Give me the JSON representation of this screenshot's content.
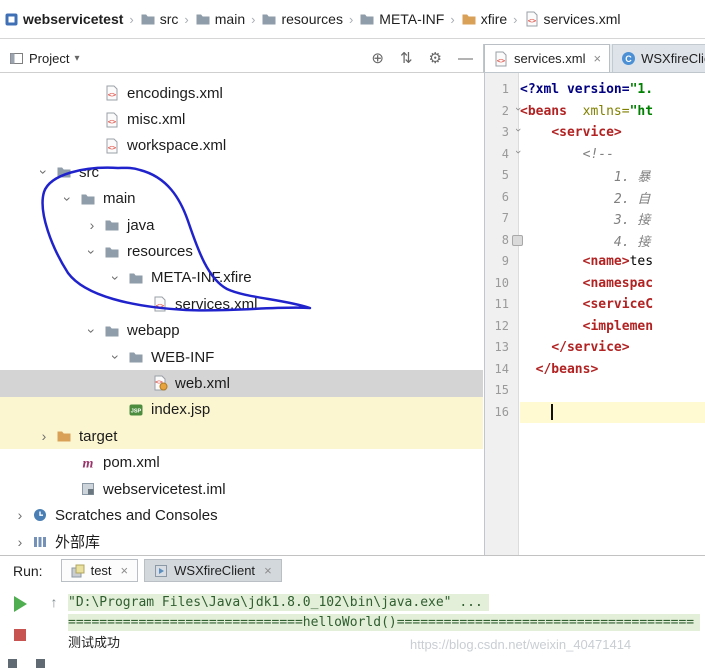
{
  "breadcrumb": {
    "separator": "›",
    "items": [
      {
        "label": "webservicetest",
        "icon": "project"
      },
      {
        "label": "src",
        "icon": "folder"
      },
      {
        "label": "main",
        "icon": "folder"
      },
      {
        "label": "resources",
        "icon": "folder"
      },
      {
        "label": "META-INF",
        "icon": "folder"
      },
      {
        "label": "xfire",
        "icon": "folder-orange"
      },
      {
        "label": "services.xml",
        "icon": "xml-file"
      }
    ]
  },
  "project_panel": {
    "title": "Project",
    "dropdown_arrow": "▾",
    "toolbar_icons": [
      {
        "name": "locate-icon",
        "glyph": "⊕"
      },
      {
        "name": "collapse-all-icon",
        "glyph": "⇅"
      },
      {
        "name": "settings-gear-icon",
        "glyph": "⚙"
      },
      {
        "name": "hide-panel-icon",
        "glyph": "—"
      }
    ],
    "tree": [
      {
        "label": "encodings.xml",
        "icon": "xml-file",
        "level": 3
      },
      {
        "label": "misc.xml",
        "icon": "xml-file",
        "level": 3
      },
      {
        "label": "workspace.xml",
        "icon": "xml-file",
        "level": 3
      },
      {
        "label": "src",
        "icon": "folder",
        "level": 1,
        "arrow": "down"
      },
      {
        "label": "main",
        "icon": "folder",
        "level": 2,
        "arrow": "down"
      },
      {
        "label": "java",
        "icon": "folder",
        "level": 3,
        "arrow": "right"
      },
      {
        "label": "resources",
        "icon": "folder",
        "level": 3,
        "arrow": "down"
      },
      {
        "label": "META-INF.xfire",
        "icon": "folder",
        "level": 4,
        "arrow": "down"
      },
      {
        "label": "services.xml",
        "icon": "xml-file",
        "level": 5
      },
      {
        "label": "webapp",
        "icon": "folder",
        "level": 3,
        "arrow": "down"
      },
      {
        "label": "WEB-INF",
        "icon": "folder",
        "level": 4,
        "arrow": "down"
      },
      {
        "label": "web.xml",
        "icon": "web-xml",
        "level": 5,
        "selected": true
      },
      {
        "label": "index.jsp",
        "icon": "jsp-file",
        "level": 4,
        "highlight": true
      },
      {
        "label": "target",
        "icon": "folder-orange",
        "level": 1,
        "arrow": "right",
        "highlight": true
      },
      {
        "label": "pom.xml",
        "icon": "maven",
        "level": 2
      },
      {
        "label": "webservicetest.iml",
        "icon": "module-file",
        "level": 2
      },
      {
        "label": "Scratches and Consoles",
        "icon": "scratches",
        "level": 0,
        "arrow": "right"
      },
      {
        "label": "外部库",
        "icon": "library",
        "level": 0,
        "arrow": "right"
      }
    ]
  },
  "editor": {
    "tabs": [
      {
        "label": "services.xml",
        "icon": "xml-file",
        "close": "×",
        "active": true
      },
      {
        "label": "WSXfireClient",
        "icon": "class",
        "close": "×",
        "active": false
      }
    ],
    "lines": [
      {
        "num": 1,
        "segments": [
          {
            "t": "<?xml version=",
            "s": "prolog"
          },
          {
            "t": "\"1.",
            "s": "string"
          }
        ]
      },
      {
        "num": 2,
        "fold": true,
        "segments": [
          {
            "t": "<beans",
            "s": "tag"
          },
          {
            "t": "  ",
            "s": "plain"
          },
          {
            "t": "xmlns=",
            "s": "attr"
          },
          {
            "t": "\"ht",
            "s": "string"
          }
        ]
      },
      {
        "num": 3,
        "fold": true,
        "segments": [
          {
            "t": "    ",
            "s": "plain"
          },
          {
            "t": "<service>",
            "s": "tag"
          }
        ]
      },
      {
        "num": 4,
        "fold": true,
        "segments": [
          {
            "t": "        ",
            "s": "plain"
          },
          {
            "t": "<!--",
            "s": "comment"
          }
        ]
      },
      {
        "num": 5,
        "segments": [
          {
            "t": "            ",
            "s": "plain"
          },
          {
            "t": "1. 暴",
            "s": "comment"
          }
        ]
      },
      {
        "num": 6,
        "segments": [
          {
            "t": "            ",
            "s": "plain"
          },
          {
            "t": "2. 自",
            "s": "comment"
          }
        ]
      },
      {
        "num": 7,
        "segments": [
          {
            "t": "            ",
            "s": "plain"
          },
          {
            "t": "3. 接",
            "s": "comment"
          }
        ]
      },
      {
        "num": 8,
        "marker": true,
        "segments": [
          {
            "t": "            ",
            "s": "plain"
          },
          {
            "t": "4. 接",
            "s": "comment"
          }
        ]
      },
      {
        "num": 9,
        "segments": [
          {
            "t": "        ",
            "s": "plain"
          },
          {
            "t": "<name>",
            "s": "tag"
          },
          {
            "t": "tes",
            "s": "plain"
          }
        ]
      },
      {
        "num": 10,
        "segments": [
          {
            "t": "        ",
            "s": "plain"
          },
          {
            "t": "<namespac",
            "s": "tag"
          }
        ]
      },
      {
        "num": 11,
        "segments": [
          {
            "t": "        ",
            "s": "plain"
          },
          {
            "t": "<serviceC",
            "s": "tag"
          }
        ]
      },
      {
        "num": 12,
        "segments": [
          {
            "t": "        ",
            "s": "plain"
          },
          {
            "t": "<implemen",
            "s": "tag"
          }
        ]
      },
      {
        "num": 13,
        "segments": [
          {
            "t": "    ",
            "s": "plain"
          },
          {
            "t": "</service>",
            "s": "tag"
          }
        ]
      },
      {
        "num": 14,
        "segments": [
          {
            "t": "  ",
            "s": "plain"
          },
          {
            "t": "</beans>",
            "s": "tag"
          }
        ]
      },
      {
        "num": 15,
        "segments": []
      },
      {
        "num": 16,
        "caret": true,
        "caret_line": true,
        "segments": [
          {
            "t": "    ",
            "s": "plain"
          }
        ]
      }
    ]
  },
  "run_panel": {
    "label": "Run:",
    "tabs": [
      {
        "label": "test",
        "icon": "test-config",
        "close": "×",
        "active": true
      },
      {
        "label": "WSXfireClient",
        "icon": "app-config",
        "close": "×",
        "active": false
      }
    ],
    "console": [
      {
        "text": "\"D:\\Program Files\\Java\\jdk1.8.0_102\\bin\\java.exe\" ...",
        "green": true
      },
      {
        "text": "==============================helloWorld()======================================",
        "green": true
      },
      {
        "text": "测试成功",
        "green": false
      }
    ]
  },
  "watermark": "https://blog.csdn.net/weixin_40471414",
  "colors": {
    "selection_row": "#d4d4d4",
    "highlight_row": "#fcf6d0",
    "caret_line": "#fffad1",
    "console_green_bg": "#e3efd9",
    "annotation_blue": "#2023cc",
    "xml_tag": "#b22222",
    "xml_string": "#008000",
    "xml_comment": "#808080",
    "xml_prolog": "#000080"
  }
}
